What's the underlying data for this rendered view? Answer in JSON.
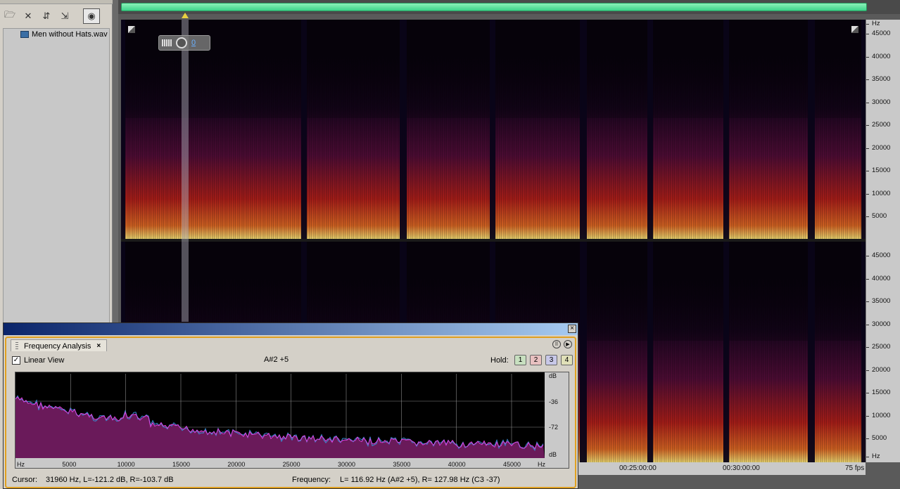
{
  "files_panel": {
    "file_name": "Men without Hats.wav"
  },
  "spectrogram": {
    "volume_value": "0",
    "hz_unit": "Hz",
    "hz_labels_top": [
      "45000",
      "40000",
      "35000",
      "30000",
      "25000",
      "20000",
      "15000",
      "10000",
      "5000"
    ],
    "hz_labels_bottom": [
      "45000",
      "40000",
      "35000",
      "30000",
      "25000",
      "20000",
      "15000",
      "10000",
      "5000"
    ],
    "timeline": {
      "labels": [
        "00:25:00:00",
        "00:30:00:00"
      ],
      "fps": "75 fps"
    }
  },
  "frequency_analysis": {
    "tab_title": "Frequency Analysis",
    "tab_close": "×",
    "linear_view_label": "Linear View",
    "linear_view_checked": "✓",
    "note_readout": "A#2 +5",
    "hold_label": "Hold:",
    "hold_buttons": [
      "1",
      "2",
      "3",
      "4"
    ],
    "db_labels": [
      "dB",
      "-36",
      "-72",
      "dB"
    ],
    "x_labels": [
      "Hz",
      "5000",
      "10000",
      "15000",
      "20000",
      "25000",
      "30000",
      "35000",
      "40000",
      "45000",
      "Hz"
    ],
    "cursor_label": "Cursor:",
    "cursor_value": "31960 Hz, L=-121.2 dB, R=-103.7 dB",
    "frequency_label": "Frequency:",
    "frequency_value": "L= 116.92 Hz (A#2 +5), R= 127.98 Hz (C3 -37)",
    "colors": {
      "fill": "#6a1a5a",
      "line_left": "#e040e0",
      "line_right": "#3a8ad0",
      "grid": "#8a8a8a"
    }
  }
}
